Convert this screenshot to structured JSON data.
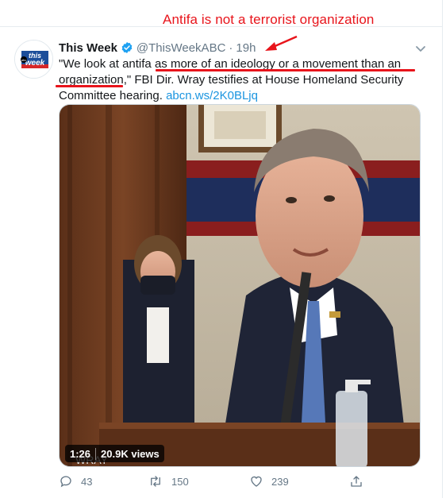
{
  "annotation": {
    "text": "Antifa is not a terrorist organization",
    "color": "#e8141b"
  },
  "tweet": {
    "author": {
      "name": "This Week",
      "handle": "@ThisWeekABC",
      "verified": true,
      "avatar_label": "this week"
    },
    "separator": "·",
    "time": "19h",
    "text_parts": {
      "p1": "\"We look at antifa as ",
      "p2": "more of an ideology or a movement than an",
      "p3": "organization",
      "p4": ",\" FBI Dir. Wray testifies at House Homeland Security Committee hearing. ",
      "link": "abcn.ws/2K0BLjq"
    },
    "media": {
      "type": "video",
      "duration": "1:26",
      "views": "20.9K views",
      "nameplate": "WRAY"
    },
    "actions": {
      "replies": "43",
      "retweets": "150",
      "likes": "239"
    }
  },
  "colors": {
    "accent": "#1b95e0",
    "muted": "#657786",
    "verified": "#1da1f2",
    "annotation": "#e8141b"
  },
  "icons": [
    "verified-badge-icon",
    "chevron-down-icon",
    "reply-icon",
    "retweet-icon",
    "like-icon",
    "share-icon"
  ]
}
